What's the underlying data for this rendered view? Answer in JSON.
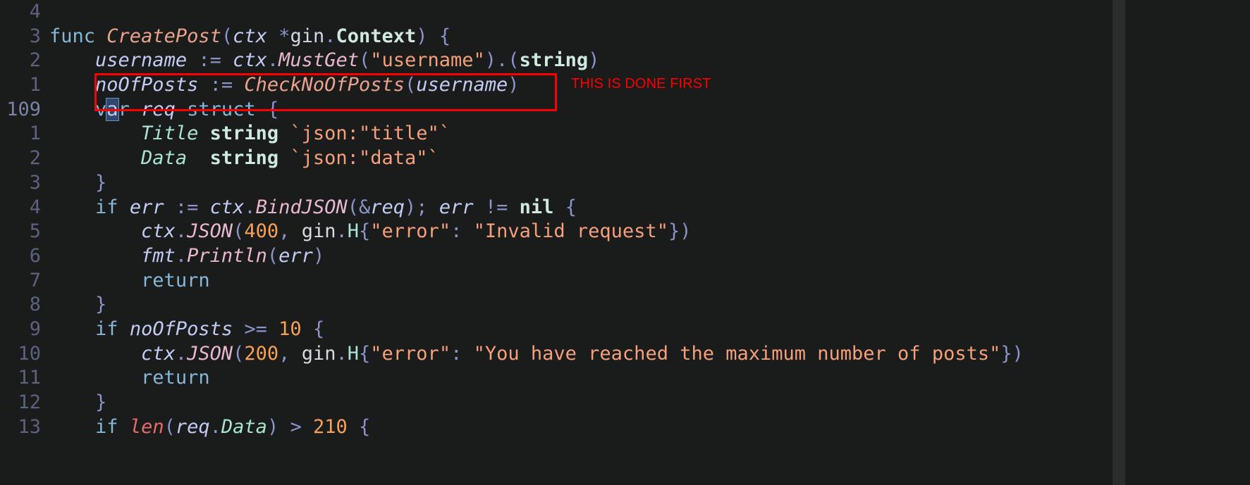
{
  "editor": {
    "theme_background": "#1a1b1b",
    "current_absolute_line": "109",
    "column_guide_color": "#2b2c2c",
    "language": "go",
    "cursor_char": "a",
    "gutter": [
      "4",
      "3",
      "2",
      "1",
      "109",
      "1",
      "2",
      "3",
      "4",
      "5",
      "6",
      "7",
      "8",
      "9",
      "10",
      "11",
      "12",
      "13"
    ],
    "lines": [
      {
        "number": "4",
        "text": ""
      },
      {
        "number": "3",
        "text": "func CreatePost(ctx *gin.Context) {"
      },
      {
        "number": "2",
        "text": "    username := ctx.MustGet(\"username\").(string)"
      },
      {
        "number": "1",
        "text": "    noOfPosts := CheckNoOfPosts(username)"
      },
      {
        "number": "109",
        "text": "    var req struct {"
      },
      {
        "number": "1",
        "text": "        Title string `json:\"title\"`"
      },
      {
        "number": "2",
        "text": "        Data  string `json:\"data\"`"
      },
      {
        "number": "3",
        "text": "    }"
      },
      {
        "number": "4",
        "text": "    if err := ctx.BindJSON(&req); err != nil {"
      },
      {
        "number": "5",
        "text": "        ctx.JSON(400, gin.H{\"error\": \"Invalid request\"})"
      },
      {
        "number": "6",
        "text": "        fmt.Println(err)"
      },
      {
        "number": "7",
        "text": "        return"
      },
      {
        "number": "8",
        "text": "    }"
      },
      {
        "number": "9",
        "text": "    if noOfPosts >= 10 {"
      },
      {
        "number": "10",
        "text": "        ctx.JSON(200, gin.H{\"error\": \"You have reached the maximum number of posts\"})"
      },
      {
        "number": "11",
        "text": "        return"
      },
      {
        "number": "12",
        "text": "    }"
      },
      {
        "number": "13",
        "text": "    if len(req.Data) > 210 {"
      }
    ]
  },
  "annotation": {
    "label": "THIS IS DONE FIRST",
    "color": "#ff0000",
    "highlighted_code": "noOfPosts := CheckNoOfPosts(username)"
  }
}
